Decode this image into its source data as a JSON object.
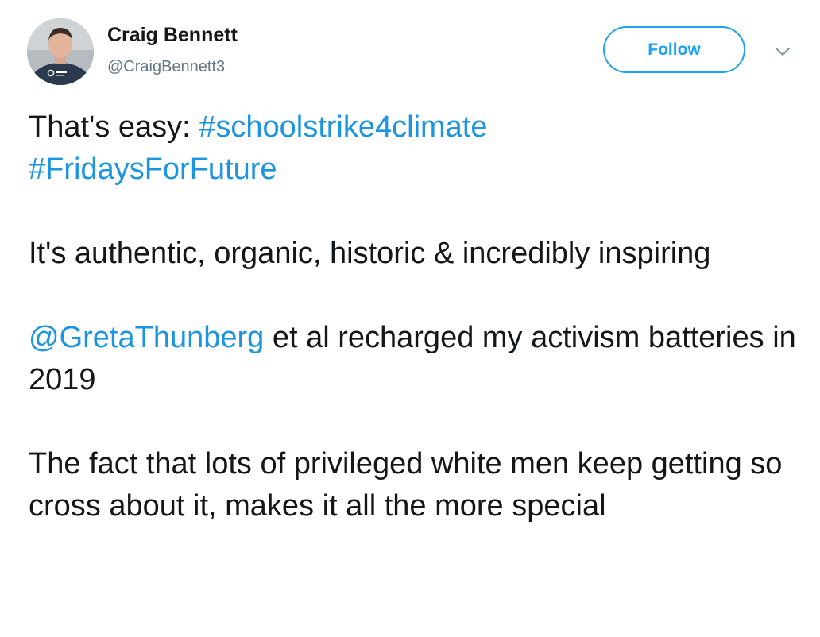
{
  "author": {
    "name": "Craig Bennett",
    "handle": "@CraigBennett3"
  },
  "actions": {
    "follow_label": "Follow",
    "menu_icon": "chevron-down-icon"
  },
  "tweet": {
    "para1_lead": "That's easy: ",
    "hashtag1": "#schoolstrike4climate",
    "hashtag2": "#FridaysForFuture",
    "para2": "It's authentic, organic, historic & incredibly inspiring",
    "mention": "@GretaThunberg",
    "para3_rest": " et al recharged my activism batteries in 2019",
    "para4": "The fact that lots of privileged white men keep getting so cross about it, makes it all the more special"
  },
  "colors": {
    "link": "#1b95e0",
    "follow_accent": "#1da1f2",
    "text": "#14171a",
    "secondary": "#657786"
  }
}
